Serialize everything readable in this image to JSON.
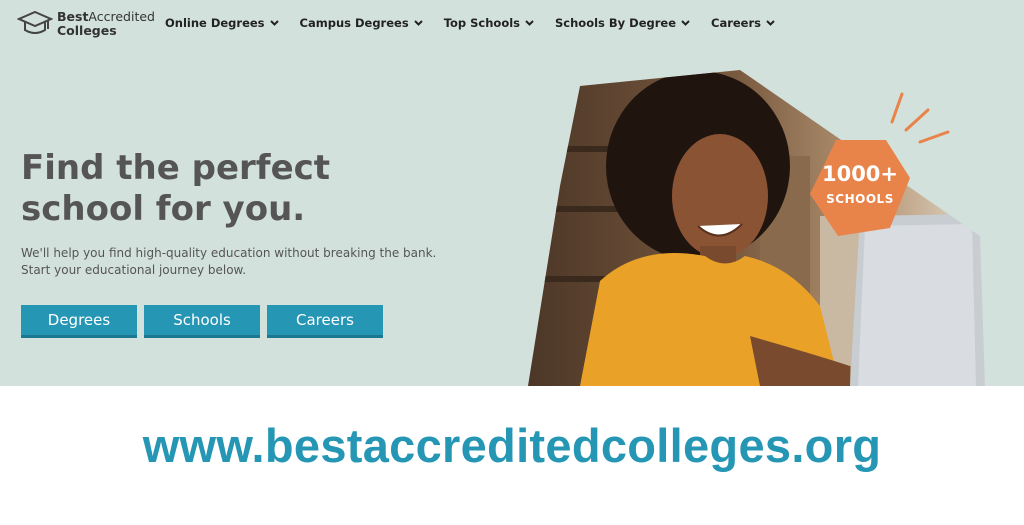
{
  "logo": {
    "line1_bold": "Best",
    "line1_light": "Accredited",
    "line2": "Colleges",
    "icon": "graduation-cap-icon"
  },
  "nav": {
    "items": [
      {
        "label": "Online Degrees"
      },
      {
        "label": "Campus Degrees"
      },
      {
        "label": "Top Schools"
      },
      {
        "label": "Schools By Degree"
      },
      {
        "label": "Careers"
      }
    ]
  },
  "hero": {
    "headline_line1": "Find the perfect",
    "headline_line2": "school for you.",
    "subtext": "We'll help you find high-quality education without breaking the bank. Start your educational journey below.",
    "buttons": [
      {
        "label": "Degrees"
      },
      {
        "label": "Schools"
      },
      {
        "label": "Careers"
      }
    ],
    "badge": {
      "count": "1000+",
      "label": "SCHOOLS"
    }
  },
  "footer": {
    "url": "www.bestaccreditedcolleges.org"
  },
  "colors": {
    "hero_bg": "#d3e1dc",
    "accent": "#2596b4",
    "badge": "#e8834a",
    "shirt": "#e9a127"
  }
}
